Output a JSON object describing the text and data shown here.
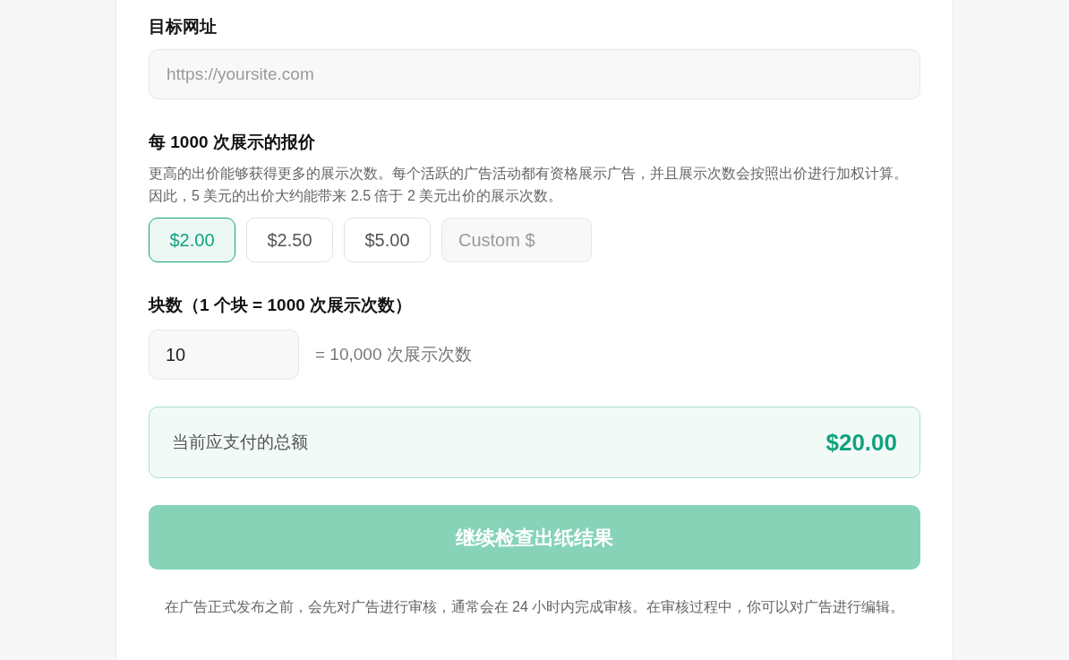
{
  "url_field": {
    "label": "目标网址",
    "placeholder": "https://yoursite.com"
  },
  "bid": {
    "label": "每 1000 次展示的报价",
    "description": "更高的出价能够获得更多的展示次数。每个活跃的广告活动都有资格展示广告，并且展示次数会按照出价进行加权计算。因此，5 美元的出价大约能带来 2.5 倍于 2 美元出价的展示次数。",
    "options": [
      {
        "label": "$2.00",
        "selected": true
      },
      {
        "label": "$2.50",
        "selected": false
      },
      {
        "label": "$5.00",
        "selected": false
      }
    ],
    "custom_placeholder": "Custom $"
  },
  "blocks": {
    "label": "块数（1 个块 = 1000 次展示次数）",
    "value": "10",
    "equivalent": "= 10,000 次展示次数"
  },
  "total": {
    "label": "当前应支付的总额",
    "amount": "$20.00"
  },
  "submit": {
    "label": "继续检查出纸结果",
    "disabled": true
  },
  "note": "在广告正式发布之前，会先对广告进行审核，通常会在 24 小时内完成审核。在审核过程中，你可以对广告进行编辑。"
}
